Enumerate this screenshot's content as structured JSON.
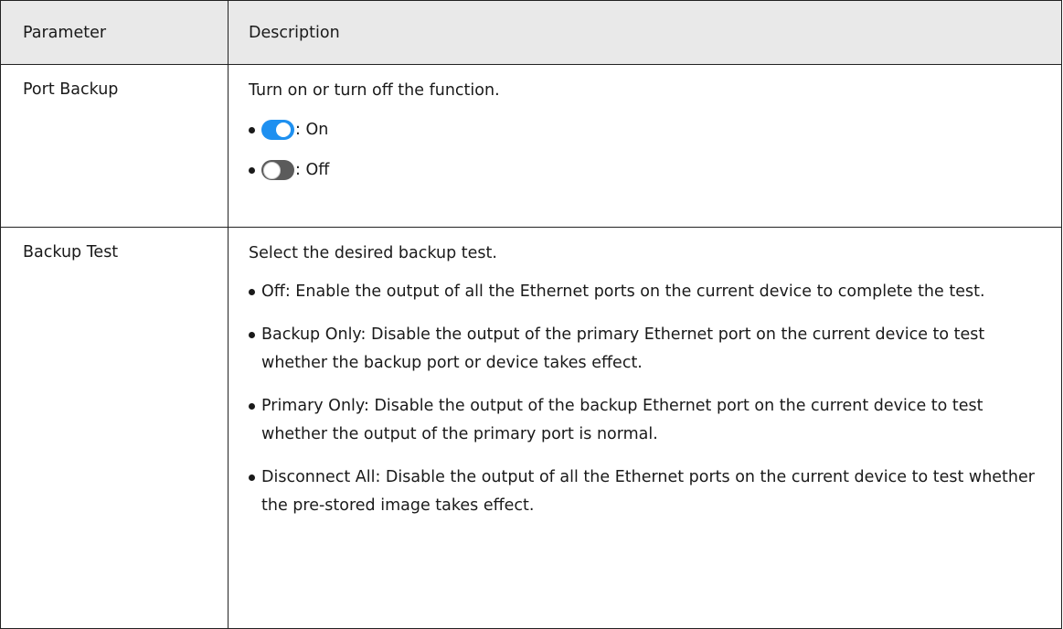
{
  "table": {
    "headers": {
      "parameter": "Parameter",
      "description": "Description"
    },
    "rows": [
      {
        "parameter": "Port Backup",
        "intro": "Turn on or turn off the function.",
        "toggles": [
          {
            "state": "on",
            "color": "#1e90f0",
            "label": ": On"
          },
          {
            "state": "off",
            "color": "#5b5b5b",
            "label": ": Off"
          }
        ]
      },
      {
        "parameter": "Backup Test",
        "intro": "Select the desired backup test.",
        "bullets": [
          "Off: Enable the output of all the Ethernet ports on the current device to complete the test.",
          "Backup Only: Disable the output of the primary Ethernet port on the current device to test whether the backup port or device takes effect.",
          "Primary Only: Disable the output of the backup Ethernet port on the current device to test whether the output of the primary port is normal.",
          "Disconnect All: Disable the output of all the Ethernet ports on the current device to test whether the pre-stored image takes effect."
        ]
      }
    ]
  }
}
